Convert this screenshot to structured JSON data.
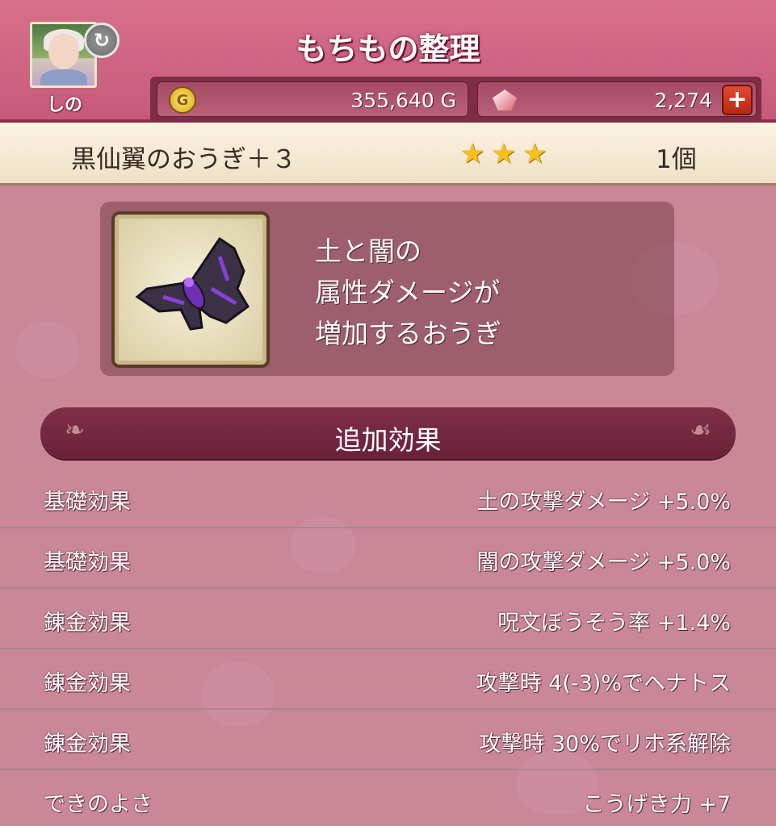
{
  "header": {
    "title": "もちもの整理",
    "character_name": "しの",
    "swap_icon": "refresh-icon",
    "gold": "355,640 G",
    "gems": "2,274",
    "coin_icon_glyph": "G",
    "plus_glyph": "+"
  },
  "item": {
    "name": "黒仙翼のおうぎ＋３",
    "stars": 3,
    "count": "1個",
    "description": [
      "土と闇の",
      "属性ダメージが",
      "増加するおうぎ"
    ]
  },
  "effects_section": {
    "title": "追加効果",
    "rows": [
      {
        "label": "基礎効果",
        "value": "土の攻撃ダメージ +5.0%"
      },
      {
        "label": "基礎効果",
        "value": "闇の攻撃ダメージ +5.0%"
      },
      {
        "label": "錬金効果",
        "value": "呪文ぼうそう率 +1.4%"
      },
      {
        "label": "錬金効果",
        "value": "攻撃時 4(-3)%でヘナトス"
      },
      {
        "label": "錬金効果",
        "value": "攻撃時 30%でリホ系解除"
      },
      {
        "label": "できのよさ",
        "value": "こうげき力 +7"
      }
    ]
  },
  "colors": {
    "header": "#d7708d",
    "background": "#c98798",
    "star": "#f6c11d",
    "section_header": "#7e2f48"
  }
}
